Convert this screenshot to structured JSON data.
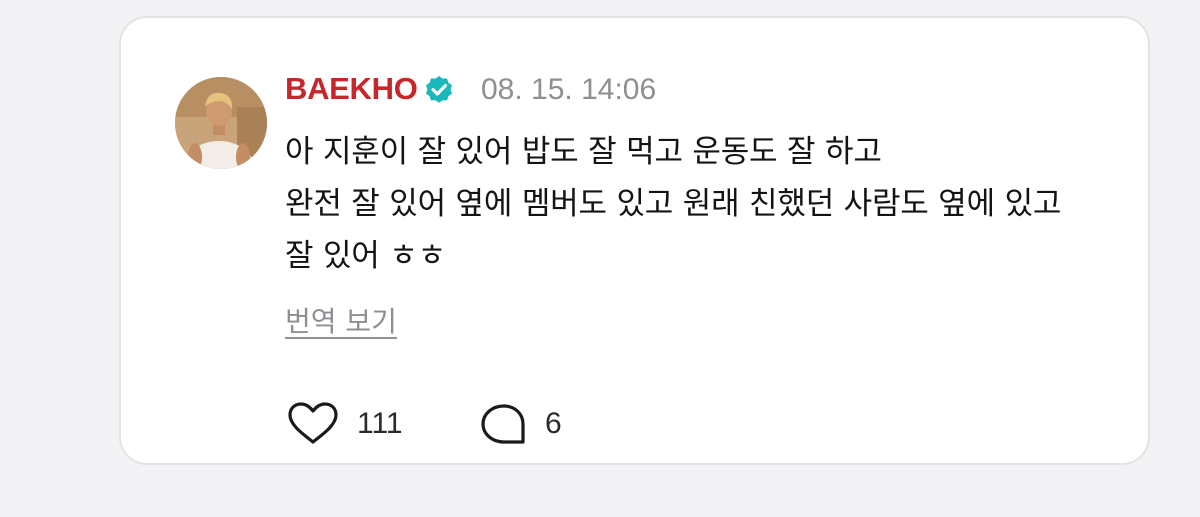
{
  "post": {
    "author": "BAEKHO",
    "author_color": "#c8262b",
    "verified_color": "#19b8ba",
    "timestamp": "08. 15. 14:06",
    "lines": [
      "아 지훈이 잘 있어 밥도 잘 먹고 운동도 잘 하고",
      "완전 잘 있어 옆에 멤버도 있고 원래 친했던 사람도 옆에 있고",
      "잘 있어 ㅎㅎ"
    ],
    "translate_label": "번역 보기",
    "likes": "111",
    "comments": "6"
  },
  "icons": {
    "avatar": "avatar-photo",
    "verified": "verified-badge-icon",
    "more": "more-vertical-icon",
    "like": "heart-outline-icon",
    "comment": "speech-bubble-icon"
  }
}
